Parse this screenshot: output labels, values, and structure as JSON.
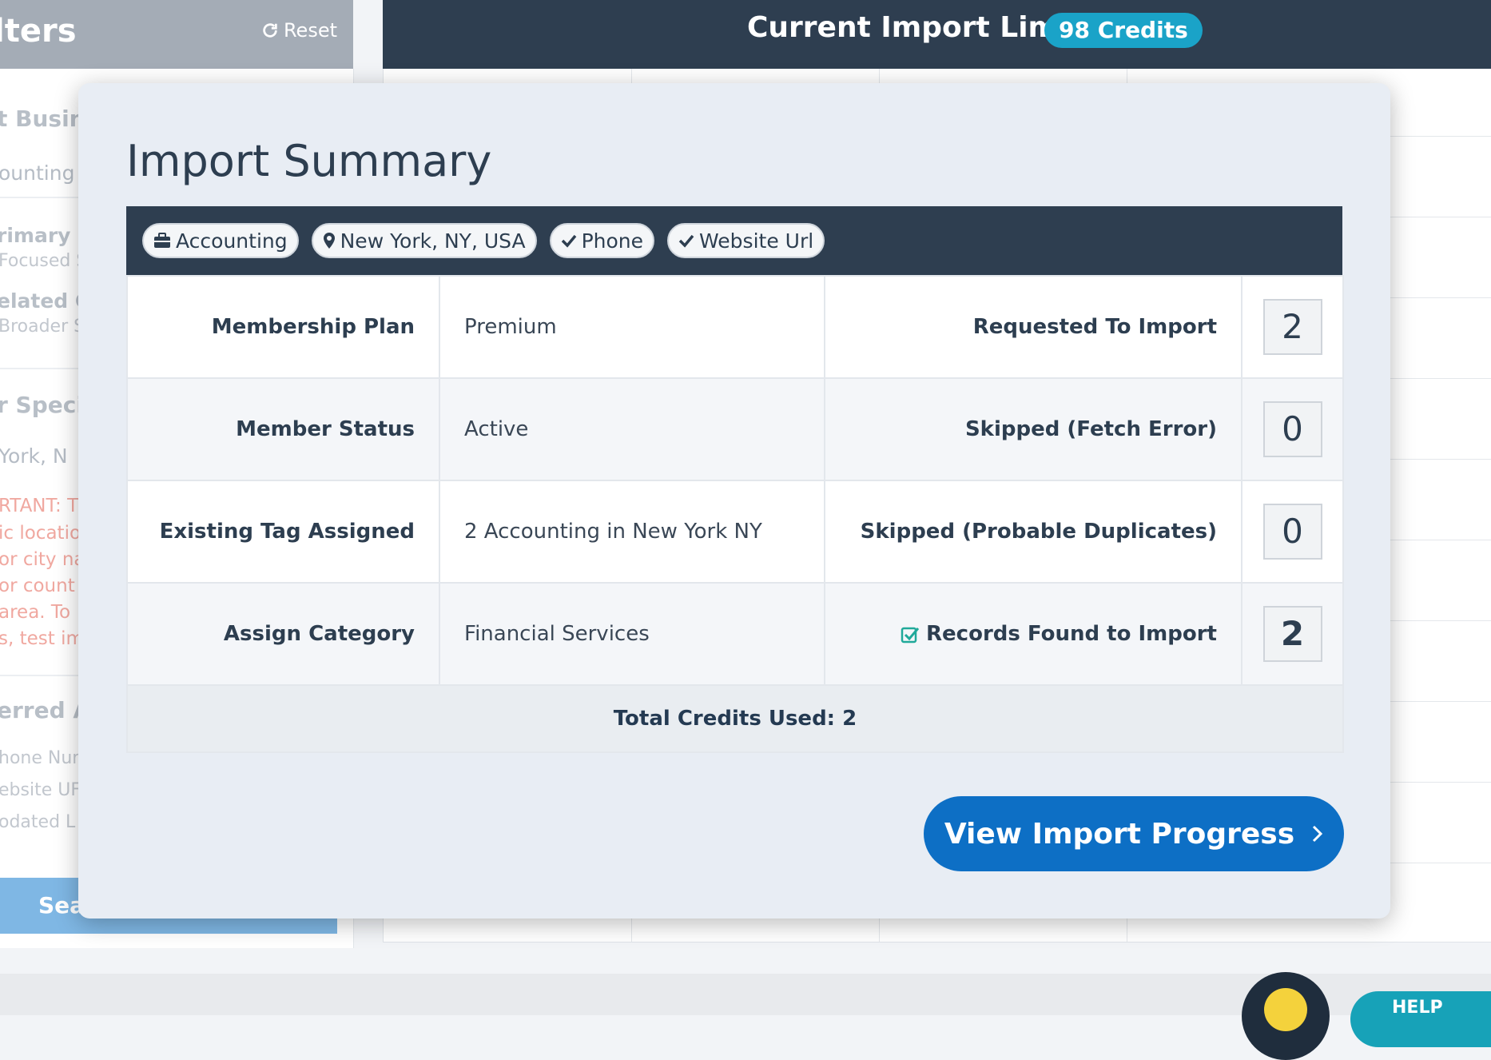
{
  "background": {
    "filters_title": "lters",
    "reset_label": "Reset",
    "sidebar_texts": {
      "business": "t Busin",
      "accounting": "ounting",
      "primary": "rimary C",
      "focused": "Focused S",
      "related": "elated C",
      "broader": "Broader S",
      "specific": "r Specif",
      "location": "York, N",
      "important": "RTANT: T",
      "warn1": "ic locatio",
      "warn2": "or city na",
      "warn3": "or count",
      "warn4": "area. To",
      "warn5": "s, test imp",
      "preferred": "erred At",
      "phone": "hone Nun",
      "website": "ebsite UF",
      "updated": "odated L"
    },
    "search_label": "Sea",
    "topbar_title": "Current Import Limit",
    "credits_badge": "98 Credits",
    "help_label": "HELP"
  },
  "modal": {
    "title": "Import Summary",
    "chips": [
      {
        "icon": "briefcase-icon",
        "label": "Accounting"
      },
      {
        "icon": "map-pin-icon",
        "label": "New York, NY, USA"
      },
      {
        "icon": "check-icon",
        "label": "Phone"
      },
      {
        "icon": "check-icon",
        "label": "Website Url"
      }
    ],
    "rows": [
      {
        "label": "Membership Plan",
        "value": "Premium",
        "stat_label": "Requested To Import",
        "stat_value": "2"
      },
      {
        "label": "Member Status",
        "value": "Active",
        "stat_label": "Skipped (Fetch Error)",
        "stat_value": "0"
      },
      {
        "label": "Existing Tag Assigned",
        "value": "2 Accounting in New York NY",
        "stat_label": "Skipped (Probable Duplicates)",
        "stat_value": "0"
      },
      {
        "label": "Assign Category",
        "value": "Financial Services",
        "stat_label": "Records Found to Import",
        "stat_value": "2"
      }
    ],
    "total": "Total Credits Used: 2",
    "view_button": "View Import Progress"
  },
  "colors": {
    "navy": "#2e3e50",
    "primary_button": "#0d6fc5",
    "badge": "#1aa3c8",
    "check": "#20a99a"
  }
}
